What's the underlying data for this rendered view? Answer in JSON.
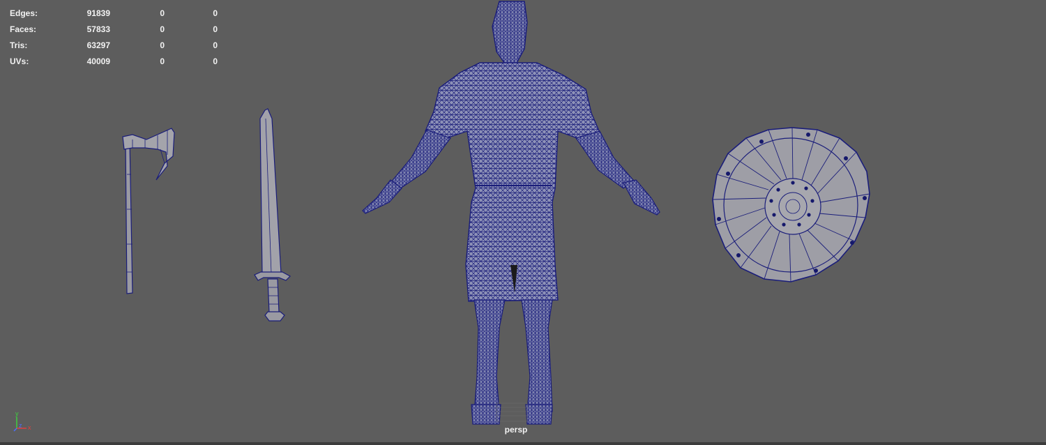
{
  "viewport": {
    "camera_name": "persp",
    "background_color": "#5d5d5d",
    "wire_color": "#1a1d7a",
    "mesh_fill_color": "#9a9aa2"
  },
  "hud": {
    "rows": [
      {
        "label": "Edges:",
        "values": [
          "91839",
          "0",
          "0"
        ]
      },
      {
        "label": "Faces:",
        "values": [
          "57833",
          "0",
          "0"
        ]
      },
      {
        "label": "Tris:",
        "values": [
          "63297",
          "0",
          "0"
        ]
      },
      {
        "label": "UVs:",
        "values": [
          "40009",
          "0",
          "0"
        ]
      }
    ]
  },
  "axis_gizmo": {
    "y_label": "y",
    "z_label": "z",
    "x_label": "x"
  },
  "scene_objects": [
    "axe-mesh",
    "sword-mesh",
    "character-mesh",
    "shield-mesh"
  ]
}
